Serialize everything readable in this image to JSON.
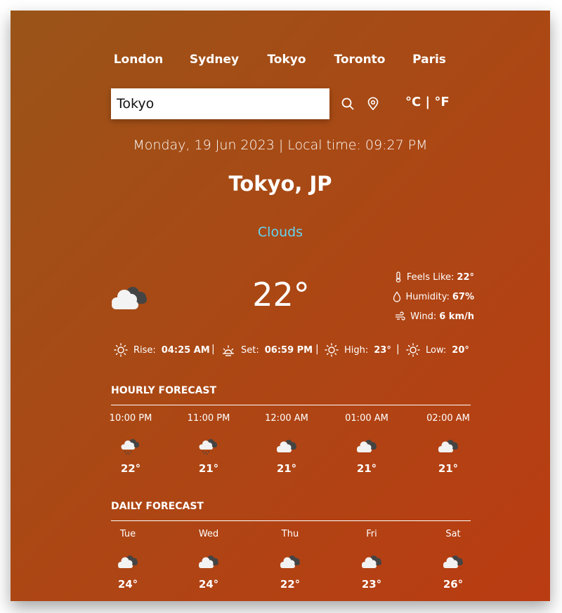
{
  "top_cities": [
    "London",
    "Sydney",
    "Tokyo",
    "Toronto",
    "Paris"
  ],
  "search": {
    "value": "Tokyo",
    "placeholder": ""
  },
  "units": {
    "celsius": "°C",
    "separator": "|",
    "fahrenheit": "°F"
  },
  "datetime": "Monday, 19 Jun 2023 | Local time: 09:27 PM",
  "location": "Tokyo, JP",
  "condition": "Clouds",
  "current": {
    "icon": "clouds-icon",
    "temperature": "22°",
    "feels_like_label": "Feels Like:",
    "feels_like_value": "22°",
    "humidity_label": "Humidity:",
    "humidity_value": "67%",
    "wind_label": "Wind:",
    "wind_value": "6 km/h"
  },
  "sun": {
    "rise_label": "Rise:",
    "rise_value": "04:25 AM",
    "set_label": "Set:",
    "set_value": "06:59 PM",
    "high_label": "High:",
    "high_value": "23°",
    "low_label": "Low:",
    "low_value": "20°",
    "separator": "|"
  },
  "hourly": {
    "title": "HOURLY FORECAST",
    "items": [
      {
        "label": "10:00 PM",
        "icon": "light-rain-icon",
        "temp": "22°"
      },
      {
        "label": "11:00 PM",
        "icon": "light-rain-icon",
        "temp": "21°"
      },
      {
        "label": "12:00 AM",
        "icon": "clouds-icon",
        "temp": "21°"
      },
      {
        "label": "01:00 AM",
        "icon": "clouds-icon",
        "temp": "21°"
      },
      {
        "label": "02:00 AM",
        "icon": "clouds-icon",
        "temp": "21°"
      }
    ]
  },
  "daily": {
    "title": "DAILY FORECAST",
    "items": [
      {
        "label": "Tue",
        "icon": "clouds-icon",
        "temp": "24°"
      },
      {
        "label": "Wed",
        "icon": "clouds-icon",
        "temp": "24°"
      },
      {
        "label": "Thu",
        "icon": "clouds-icon",
        "temp": "22°"
      },
      {
        "label": "Fri",
        "icon": "clouds-icon",
        "temp": "23°"
      },
      {
        "label": "Sat",
        "icon": "clouds-icon",
        "temp": "26°"
      }
    ]
  },
  "colors": {
    "background_start": "#9a5418",
    "background_end": "#ba3c12",
    "condition_text": "#67d3ef",
    "text": "#ffffff"
  }
}
